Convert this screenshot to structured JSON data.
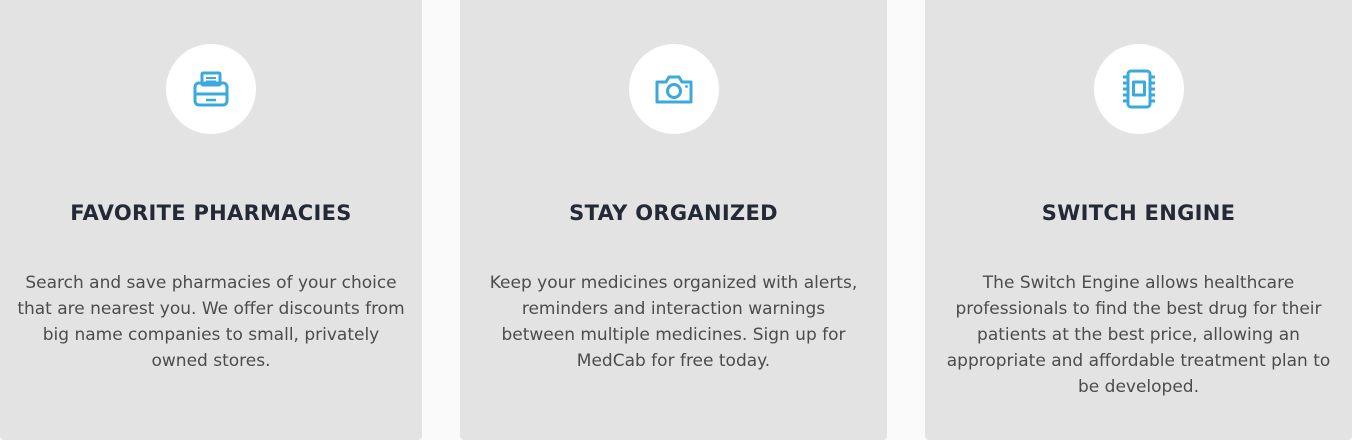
{
  "accent_color": "#3aa9dc",
  "cards": [
    {
      "icon": "printer-icon",
      "title": "FAVORITE PHARMACIES",
      "description": "Search and save pharmacies of your choice that are nearest you. We offer discounts from big name companies to small, privately owned stores."
    },
    {
      "icon": "camera-icon",
      "title": "STAY ORGANIZED",
      "description": "Keep your medicines organized with alerts, reminders and interaction warnings between multiple medicines. Sign up for MedCab for free today."
    },
    {
      "icon": "chip-icon",
      "title": "SWITCH ENGINE",
      "description": "The Switch Engine allows healthcare professionals to find the best drug for their patients at the best price, allowing an appropriate and affordable treatment plan to be developed."
    }
  ]
}
